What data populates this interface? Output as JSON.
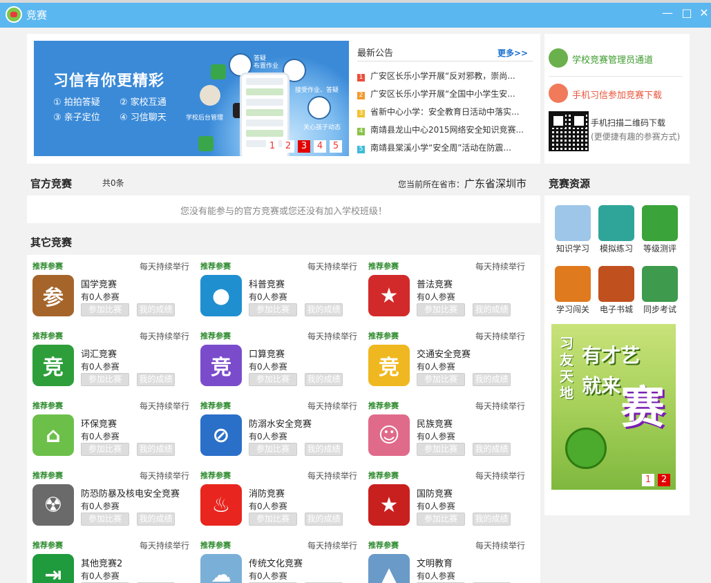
{
  "window": {
    "title": "竞赛",
    "minimize": "—",
    "maximize": "□",
    "close": "✕"
  },
  "banner": {
    "headline": "习信有你更精彩",
    "features": [
      "① 拍拍答疑",
      "② 家校互通",
      "③ 亲子定位",
      "④ 习信聊天"
    ],
    "labels": [
      "答疑",
      "布置作业",
      "接受作业、答疑",
      "关心孩子动态",
      "学校后台管理"
    ],
    "pages": [
      "1",
      "2",
      "3",
      "4",
      "5"
    ],
    "active_page": "3"
  },
  "announcements": {
    "heading": "最新公告",
    "more": "更多>>",
    "items": [
      {
        "num": "1",
        "color": "#e9513d",
        "text": "广安区长乐小学开展“反对邪教，崇尚..."
      },
      {
        "num": "2",
        "color": "#f39a2e",
        "text": "广安区长乐小学开展“全国中小学生安..."
      },
      {
        "num": "3",
        "color": "#f1c232",
        "text": "省新中心小学：安全教育日活动中落实..."
      },
      {
        "num": "4",
        "color": "#8bc34a",
        "text": "南靖县龙山中心2015网络安全知识竞赛..."
      },
      {
        "num": "5",
        "color": "#3cbcd8",
        "text": "南靖县棠溪小学“安全周”活动在防震..."
      }
    ]
  },
  "sidebar": {
    "admin_link": "学校竞赛管理员通道",
    "download_link": "手机习信参加竞赛下载",
    "qr_line1": "手机扫描二维码下载",
    "qr_line2": "(更便捷有趣的参赛方式)",
    "resources_title": "竞赛资源",
    "resources": [
      {
        "label": "知识学习",
        "color": "#9ec6e8"
      },
      {
        "label": "模拟练习",
        "color": "#2fa59a"
      },
      {
        "label": "等级测评",
        "color": "#3aa33a"
      },
      {
        "label": "学习闯关",
        "color": "#e07a1e"
      },
      {
        "label": "电子书城",
        "color": "#c0501e"
      },
      {
        "label": "同步考试",
        "color": "#3e9a4c"
      }
    ],
    "poster": {
      "vertical": "习友天地",
      "headline": "有才艺就来",
      "big": "赛",
      "pages": [
        "1",
        "2"
      ],
      "active_page": "2"
    }
  },
  "official": {
    "title": "官方竞赛",
    "count": "共0条",
    "location_label": "您当前所在省市：",
    "location": "广东省深圳市",
    "empty": "您没有能参与的官方竞赛或您还没有加入学校班级！"
  },
  "others": {
    "title": "其它竞赛",
    "tag": "推荐参赛",
    "freq": "每天持续举行",
    "count_text": "有0人参赛",
    "join_label": "参加比赛",
    "score_label": "我的成绩",
    "items": [
      {
        "name": "国学竞赛",
        "glyph": "参",
        "color": "#a5652a"
      },
      {
        "name": "科普竞赛",
        "glyph": "●",
        "color": "#1f8fd0"
      },
      {
        "name": "普法竞赛",
        "glyph": "★",
        "color": "#d22a2a"
      },
      {
        "name": "词汇竞赛",
        "glyph": "竞",
        "color": "#2e9e3a"
      },
      {
        "name": "口算竞赛",
        "glyph": "竞",
        "color": "#7a4ccc"
      },
      {
        "name": "交通安全竞赛",
        "glyph": "竞",
        "color": "#f0b820"
      },
      {
        "name": "环保竞赛",
        "glyph": "⌂",
        "color": "#6cc04a"
      },
      {
        "name": "防溺水安全竞赛",
        "glyph": "⊘",
        "color": "#2a6fc8"
      },
      {
        "name": "民族竞赛",
        "glyph": "☺",
        "color": "#e06a8a"
      },
      {
        "name": "防恐防暴及核电安全竞赛",
        "glyph": "☢",
        "color": "#6a6a6a"
      },
      {
        "name": "消防竞赛",
        "glyph": "♨",
        "color": "#e8251e"
      },
      {
        "name": "国防竞赛",
        "glyph": "★",
        "color": "#c8201e"
      },
      {
        "name": "其他竞赛2",
        "glyph": "⇥",
        "color": "#1f9a3c"
      },
      {
        "name": "传统文化竞赛",
        "glyph": "☁",
        "color": "#7ab0d8"
      },
      {
        "name": "文明教育",
        "glyph": "▲",
        "color": "#6a9ac8"
      }
    ]
  }
}
